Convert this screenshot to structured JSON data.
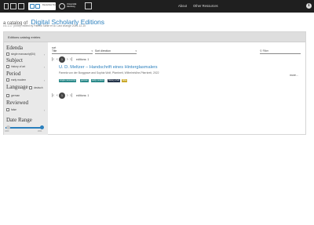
{
  "nav": {
    "about": "About",
    "other": "Other Resources"
  },
  "logos": {
    "first": "Deutsches Textarchiv",
    "second": "Universität Hamburg"
  },
  "header": {
    "prefix": "a catalog of",
    "title": "Digital Scholarly Editions",
    "subline": "v.4.1.17 (0094), edited by Patrick Sahle et al. Last change 2024-12-10"
  },
  "panel": {
    "title": "Editions catalog entries"
  },
  "sidebar": {
    "edenda": "Edenda",
    "edenda_item": "single manuscript",
    "edenda_count": "(34)",
    "subject": "Subject",
    "subject_item": "history of art",
    "period": "Period",
    "period_item": "early modern",
    "language": "Language",
    "language_item1": "german",
    "language_item2": "deutsch",
    "reviewed": "Reviewed",
    "reviewed_item": "false",
    "daterange": "Date Range",
    "date_min_label": "1000",
    "date_max_label": "2024"
  },
  "sort": {
    "label": "sort",
    "field": "Title",
    "direction": "Sort direction",
    "filter_placeholder": "Filter"
  },
  "pager": {
    "current": "1",
    "summary": "editions: 1"
  },
  "result": {
    "title": "U. D. Meltzer – Handschrift eines Hinterglasmalers",
    "subtitle": "Pamela von der Burggrave and Sophia Wolf, Pfarrkreit, Wilhelmhöhe-Pfarrkreit, 2022",
    "more": "more...",
    "badges": [
      "single manuscript",
      "german",
      "early modern",
      "history of art",
      "false"
    ]
  },
  "colors": {
    "accent": "#2a7fbd",
    "topbar": "#1f1f1f",
    "badge_teal": "#2b8a8a",
    "badge_dark": "#23344a",
    "badge_yellow": "#c9a92c"
  }
}
